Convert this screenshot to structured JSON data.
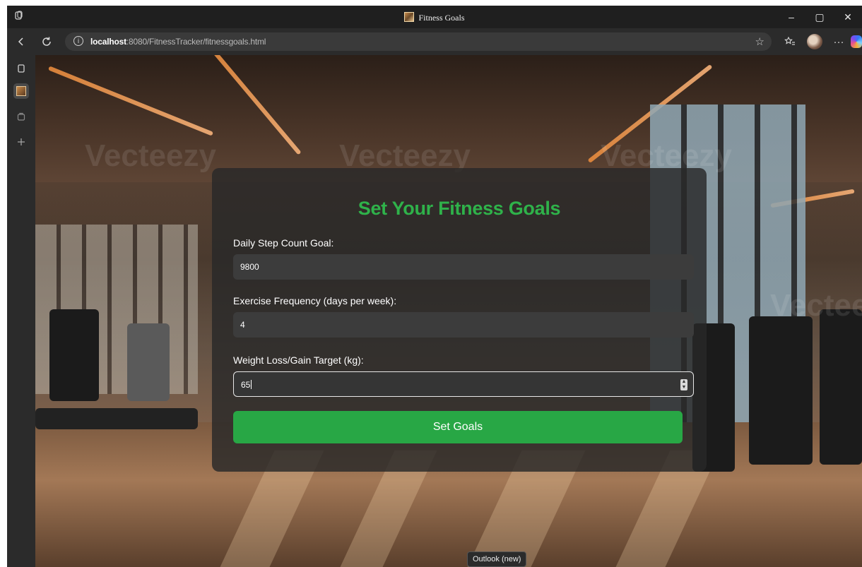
{
  "window": {
    "tab_title": "Fitness Goals",
    "controls": {
      "minimize": "–",
      "restore": "▢",
      "close": "✕"
    }
  },
  "navbar": {
    "back_icon": "back-arrow-icon",
    "reload_icon": "reload-icon",
    "url_host": "localhost",
    "url_path": ":8080/FitnessTracker/fitnessgoals.html",
    "icons": [
      "info-icon",
      "favorite-star-icon",
      "favorites-icon",
      "profile-avatar",
      "more-icon",
      "copilot-icon"
    ],
    "more_label": "···"
  },
  "sidebar": {
    "items": [
      "tab-actions-icon",
      "fitness-goals-tab",
      "workspace-icon",
      "new-tab-plus-icon"
    ]
  },
  "page": {
    "watermark": "Vecteezy",
    "form": {
      "title": "Set Your Fitness Goals",
      "fields": [
        {
          "label": "Daily Step Count Goal:",
          "value": "9800"
        },
        {
          "label": "Exercise Frequency (days per week):",
          "value": "4"
        },
        {
          "label": "Weight Loss/Gain Target (kg):",
          "value": "65"
        }
      ],
      "submit_label": "Set Goals"
    }
  },
  "tooltip": "Outlook (new)",
  "colors": {
    "accent_green": "#28a745",
    "title_green": "#2fb24a",
    "card_bg": "rgba(40,40,40,0.82)"
  }
}
